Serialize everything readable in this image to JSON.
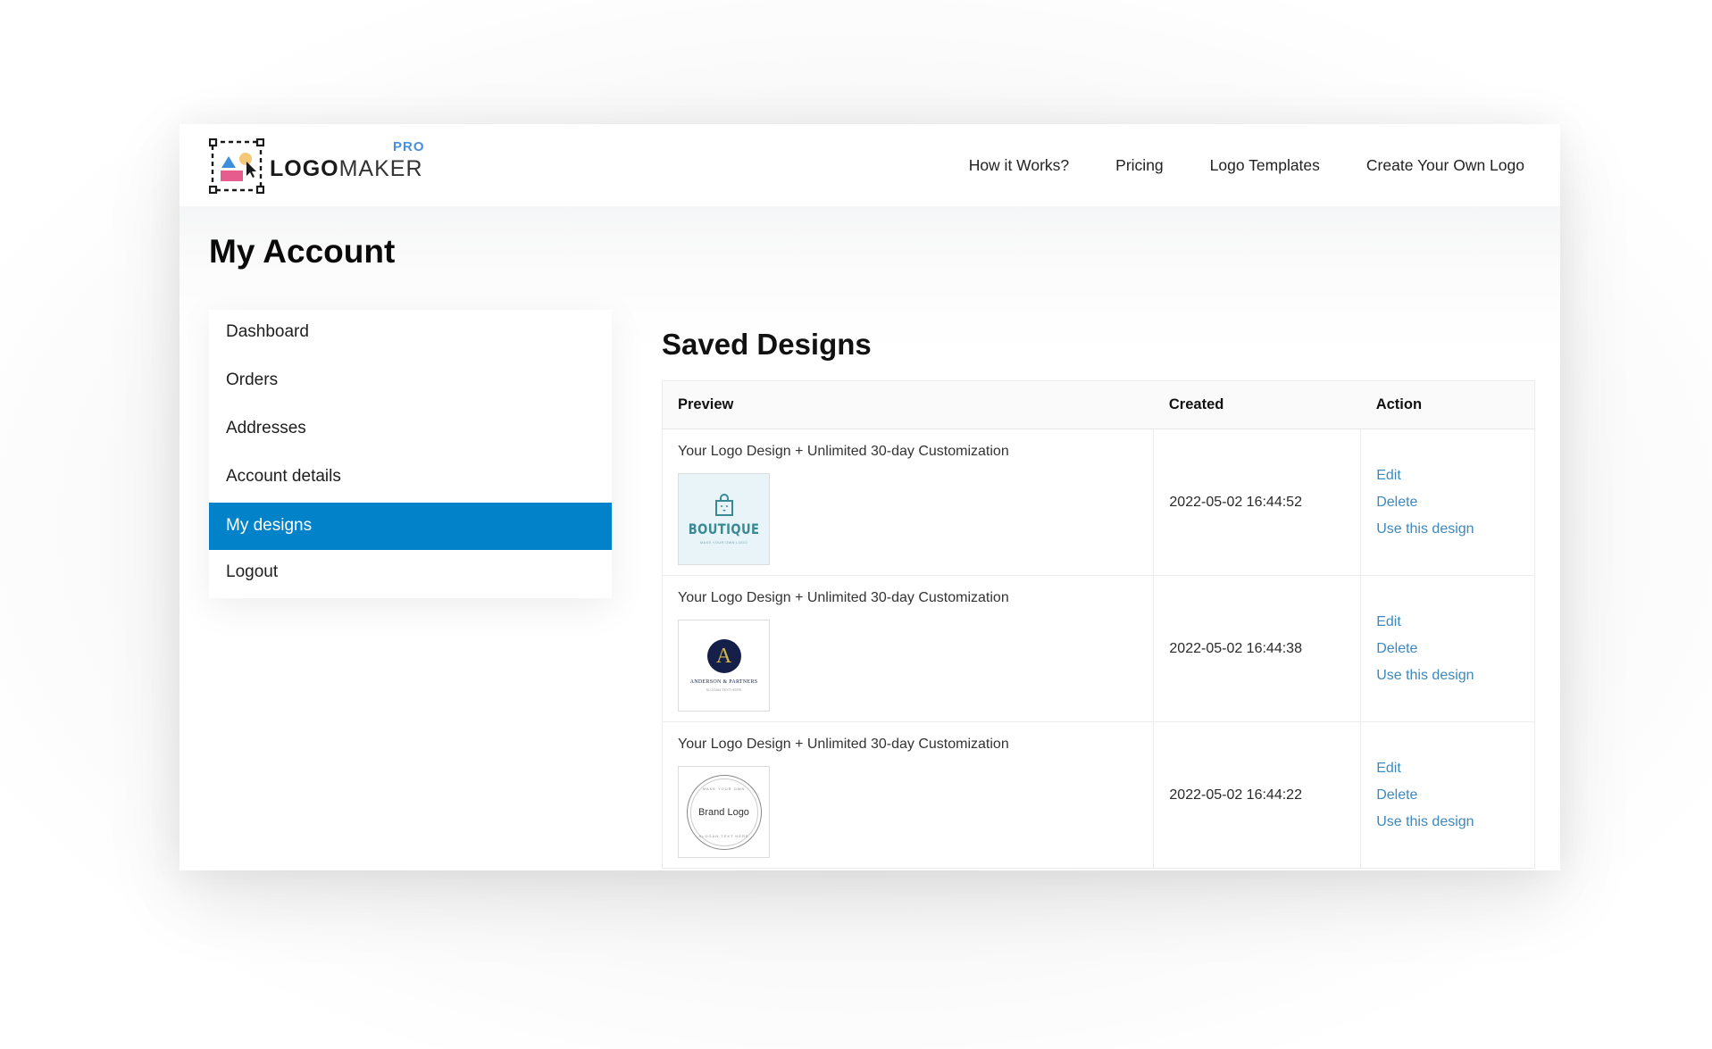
{
  "brand": {
    "logo_bold": "LOGO",
    "logo_light": "MAKER",
    "logo_badge": "PRO",
    "colors": {
      "accent": "#0282C9",
      "link": "#3D88BD",
      "badge": "#4A90D9",
      "logo_triangle": "#3E8FDC",
      "logo_circle": "#F4C878",
      "logo_rect": "#E65C8C"
    }
  },
  "nav": {
    "items": [
      {
        "label": "How it Works?"
      },
      {
        "label": "Pricing"
      },
      {
        "label": "Logo Templates"
      },
      {
        "label": "Create Your Own Logo"
      }
    ]
  },
  "page": {
    "title": "My Account"
  },
  "sidebar": {
    "active_index": 4,
    "items": [
      {
        "label": "Dashboard"
      },
      {
        "label": "Orders"
      },
      {
        "label": "Addresses"
      },
      {
        "label": "Account details"
      },
      {
        "label": "My designs"
      },
      {
        "label": "Logout"
      }
    ]
  },
  "saved_designs": {
    "title": "Saved Designs",
    "columns": {
      "preview": "Preview",
      "created": "Created",
      "action": "Action"
    },
    "rows": [
      {
        "product": "Your Logo Design + Unlimited 30-day Customization",
        "thumbnail": {
          "kind": "boutique",
          "main_text": "BOUTIQUE",
          "sub_text": "MAKE YOUR OWN LOGO"
        },
        "created": "2022-05-02 16:44:52",
        "actions": {
          "edit": "Edit",
          "delete": "Delete",
          "use": "Use this design"
        }
      },
      {
        "product": "Your Logo Design + Unlimited 30-day Customization",
        "thumbnail": {
          "kind": "anderson",
          "main_text": "A",
          "sub_text": "ANDERSON & PARTNERS",
          "tag_text": "SLOGAN TEXT HERE"
        },
        "created": "2022-05-02 16:44:38",
        "actions": {
          "edit": "Edit",
          "delete": "Delete",
          "use": "Use this design"
        }
      },
      {
        "product": "Your Logo Design + Unlimited 30-day Customization",
        "thumbnail": {
          "kind": "brand",
          "main_text": "Brand Logo",
          "ring_top": "MAKE YOUR OWN",
          "ring_bottom": "SLOGAN TEXT HERE"
        },
        "created": "2022-05-02 16:44:22",
        "actions": {
          "edit": "Edit",
          "delete": "Delete",
          "use": "Use this design"
        }
      }
    ]
  }
}
